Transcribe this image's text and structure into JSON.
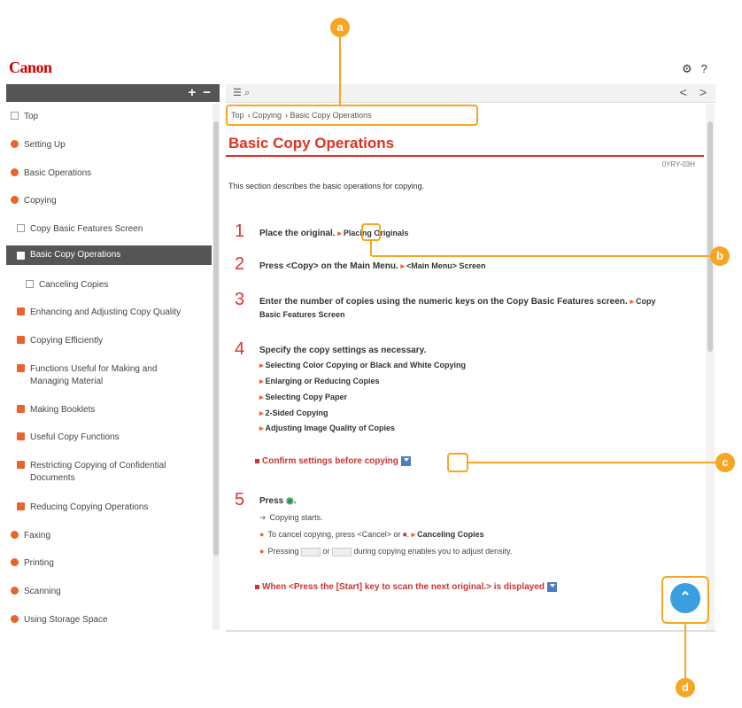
{
  "header": {
    "logo": "Canon",
    "settings_icon": "gear-icon",
    "help_label": "?"
  },
  "sidebar": {
    "toolbar": {
      "expand_label": "+",
      "collapse_label": "−"
    },
    "items": [
      {
        "label": "Top",
        "icon": "box",
        "level": 0
      },
      {
        "label": "Setting Up",
        "icon": "plus",
        "level": 0
      },
      {
        "label": "Basic Operations",
        "icon": "plus",
        "level": 0
      },
      {
        "label": "Copying",
        "icon": "plus",
        "level": 0
      },
      {
        "label": "Copy Basic Features Screen",
        "icon": "box",
        "level": 1
      },
      {
        "label": "Basic Copy Operations",
        "icon": "sq",
        "level": 1,
        "active": true
      },
      {
        "label": "Canceling Copies",
        "icon": "box",
        "level": 2
      },
      {
        "label": "Enhancing and Adjusting Copy Quality",
        "icon": "sq",
        "level": 1
      },
      {
        "label": "Copying Efficiently",
        "icon": "sq",
        "level": 1
      },
      {
        "label": "Functions Useful for Making and Managing Material",
        "icon": "sq",
        "level": 1
      },
      {
        "label": "Making Booklets",
        "icon": "sq",
        "level": 1
      },
      {
        "label": "Useful Copy Functions",
        "icon": "sq",
        "level": 1
      },
      {
        "label": "Restricting Copying of Confidential Documents",
        "icon": "sq",
        "level": 1
      },
      {
        "label": "Reducing Copying Operations",
        "icon": "sq",
        "level": 1
      },
      {
        "label": "Faxing",
        "icon": "plus",
        "level": 0
      },
      {
        "label": "Printing",
        "icon": "plus",
        "level": 0
      },
      {
        "label": "Scanning",
        "icon": "plus",
        "level": 0
      },
      {
        "label": "Using Storage Space",
        "icon": "plus",
        "level": 0
      }
    ]
  },
  "toolbar": {
    "toc_icon": "☰",
    "search_icon": "🔍",
    "prev": "<",
    "next": ">"
  },
  "content": {
    "breadcrumb": [
      "Top",
      "› Copying",
      "› Basic Copy Operations"
    ],
    "title": "Basic Copy Operations",
    "doc_id": "0YRY-03H",
    "intro": "This section describes the basic operations for copying.",
    "steps": [
      {
        "num": "1",
        "text": "Place the original.",
        "link": "Placing Originals"
      },
      {
        "num": "2",
        "text": "Press <Copy> on the Main Menu.",
        "link": "<Main Menu> Screen"
      },
      {
        "num": "3",
        "text": "Enter the number of copies using the numeric keys on the Copy Basic Features screen.",
        "link": "Copy Basic Features Screen"
      },
      {
        "num": "4",
        "text": "Specify the copy settings as necessary."
      },
      {
        "num": "5",
        "text": "Press"
      }
    ],
    "step4_links": [
      "Selecting Color Copying or Black and White Copying",
      "Enlarging or Reducing Copies",
      "Selecting Copy Paper",
      "2-Sided Copying",
      "Adjusting Image Quality of Copies"
    ],
    "confirm_label": "Confirm settings before copying",
    "step5_notes": {
      "result": "Copying starts.",
      "cancel_prefix": "To cancel copying, press <Cancel> or",
      "cancel_link": "Canceling Copies",
      "density_prefix": "Pressing",
      "density_or": "or",
      "density_suffix": "during copying enables you to adjust density."
    },
    "press_start_label": "When <Press the [Start] key to scan the next original.> is displayed"
  },
  "top_button": "⌃",
  "callouts": [
    "a",
    "b",
    "c",
    "d"
  ],
  "colors": {
    "accent": "#d32",
    "callout": "#f5a623",
    "top_button": "#3a9fe0",
    "sidebar_active": "#555"
  }
}
